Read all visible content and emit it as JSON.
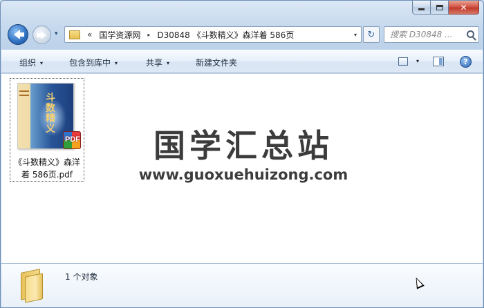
{
  "window": {
    "caption_buttons": [
      "minimize-icon",
      "maximize-icon",
      "close-icon"
    ],
    "close_glyph": "✕"
  },
  "nav": {
    "back_icon": "back-arrow-icon",
    "forward_icon": "forward-arrow-icon",
    "recent_glyph": "▾",
    "address": {
      "overflow_glyph": "«",
      "crumbs": [
        "国学资源网",
        "D30848 《斗数精义》森洋着 586页"
      ],
      "separator_glyph": "▸",
      "drop_glyph": "▾"
    },
    "refresh_glyph": "↻",
    "search": {
      "placeholder": "搜索 D30848 ..."
    }
  },
  "toolbar": {
    "organize": "组织",
    "include_library": "包含到库中",
    "share": "共享",
    "new_folder": "新建文件夹",
    "caret": "▾",
    "help_glyph": "?"
  },
  "content": {
    "file": {
      "name_line1": "《斗数精义》森洋",
      "name_line2": "着 586页.pdf",
      "thumb_title": "斗数精义",
      "badge": "PDF"
    },
    "watermark": {
      "cn": "国学汇总站",
      "url": "www.guoxuehuizong.com"
    }
  },
  "status": {
    "count_text": "1 个对象"
  }
}
